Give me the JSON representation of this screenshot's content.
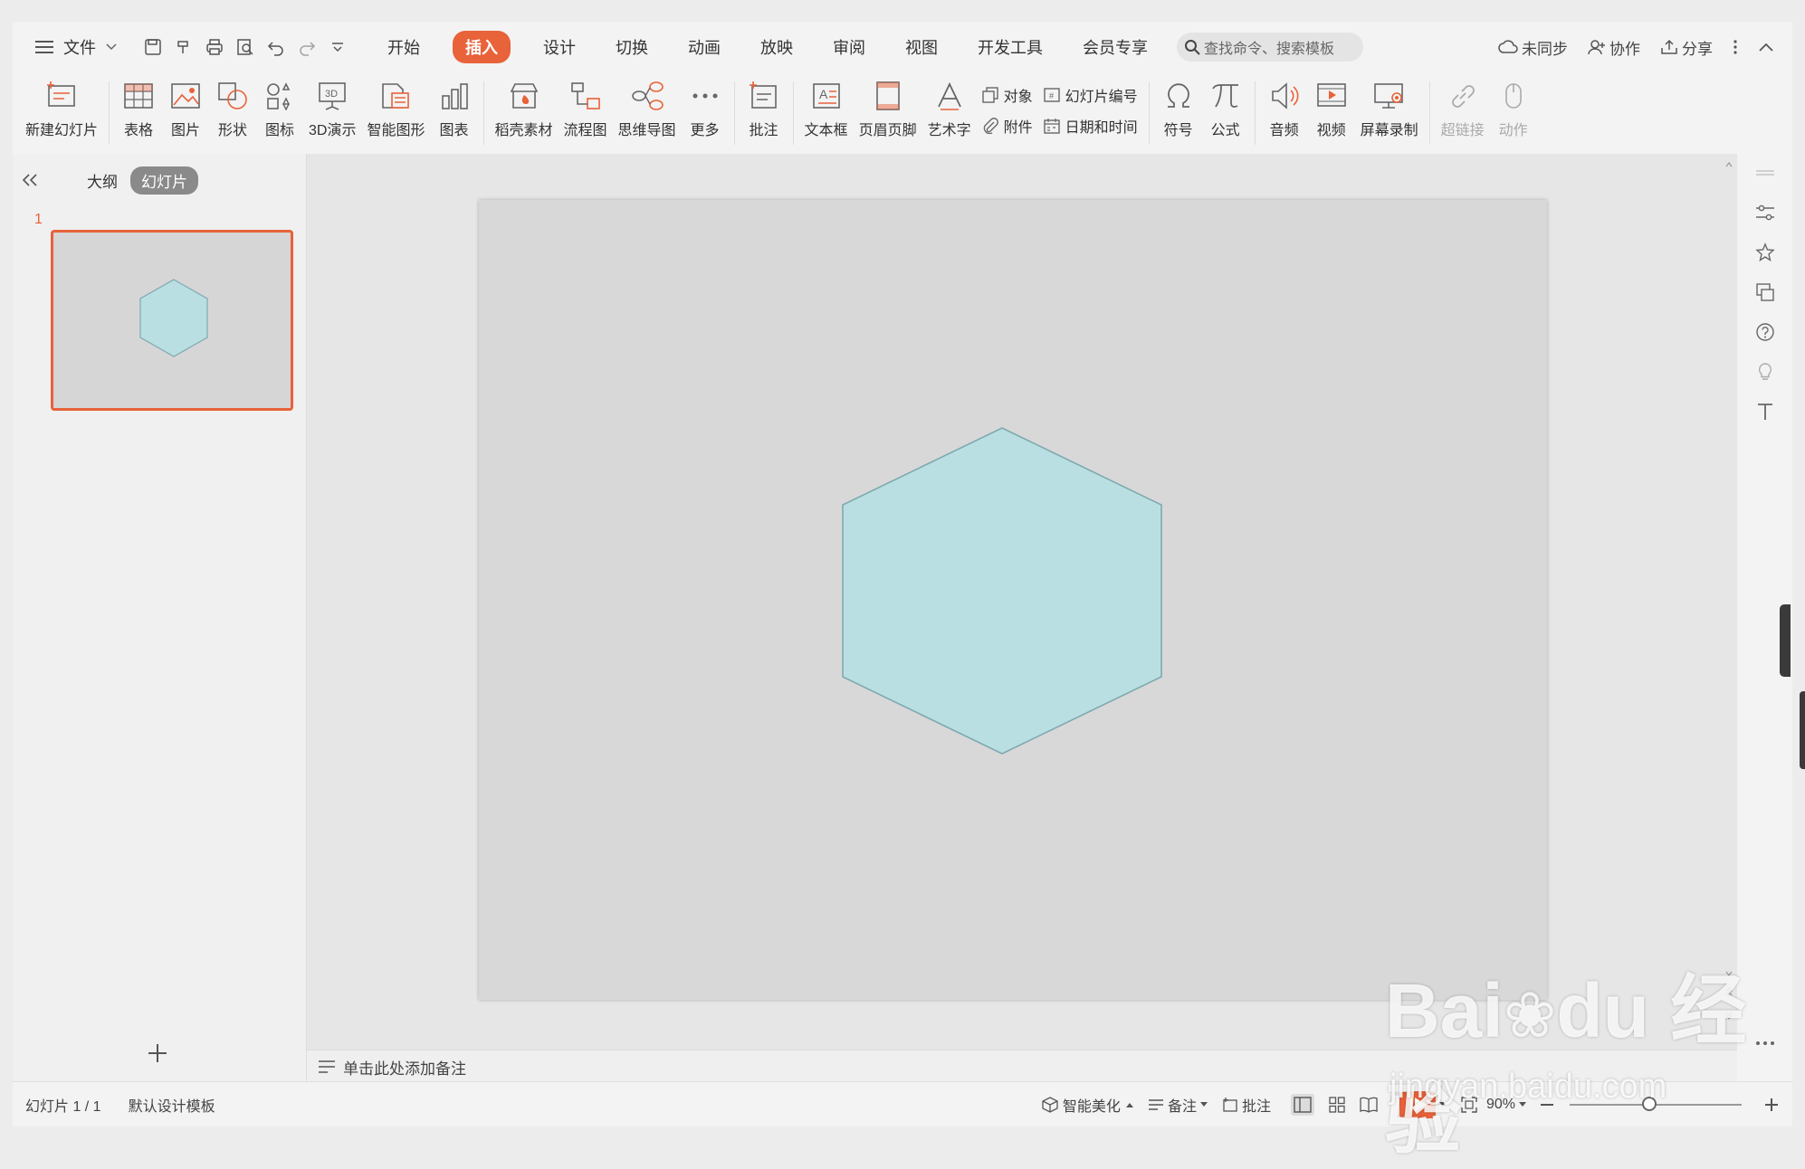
{
  "menu": {
    "file_label": "文件",
    "tabs": [
      "开始",
      "插入",
      "设计",
      "切换",
      "动画",
      "放映",
      "审阅",
      "视图",
      "开发工具",
      "会员专享"
    ],
    "active_tab": "插入",
    "search_placeholder": "查找命令、搜索模板",
    "right": {
      "sync": "未同步",
      "collab": "协作",
      "share": "分享"
    }
  },
  "ribbon": {
    "new_slide": "新建幻灯片",
    "table": "表格",
    "picture": "图片",
    "shape": "形状",
    "icon": "图标",
    "demo3d": "3D演示",
    "smartart": "智能图形",
    "chart": "图表",
    "material": "稻壳素材",
    "flowchart": "流程图",
    "mindmap": "思维导图",
    "more": "更多",
    "comment": "批注",
    "textbox": "文本框",
    "header_footer": "页眉页脚",
    "wordart": "艺术字",
    "object": "对象",
    "attachment": "附件",
    "slide_number": "幻灯片编号",
    "datetime": "日期和时间",
    "symbol": "符号",
    "formula": "公式",
    "audio": "音频",
    "video": "视频",
    "screen_record": "屏幕录制",
    "hyperlink": "超链接",
    "action": "动作"
  },
  "left_panel": {
    "tab_outline": "大纲",
    "tab_slides": "幻灯片",
    "slide_number": "1"
  },
  "notes_placeholder": "单击此处添加备注",
  "status": {
    "slide_info": "幻灯片 1 / 1",
    "template": "默认设计模板",
    "beautify": "智能美化",
    "notes": "备注",
    "comment": "批注",
    "zoom": "90%"
  },
  "colors": {
    "accent": "#e8623a",
    "hexagon_fill": "#b9dfe2",
    "hexagon_stroke": "#7fa9b0",
    "slide_bg": "#d8d8d8"
  }
}
